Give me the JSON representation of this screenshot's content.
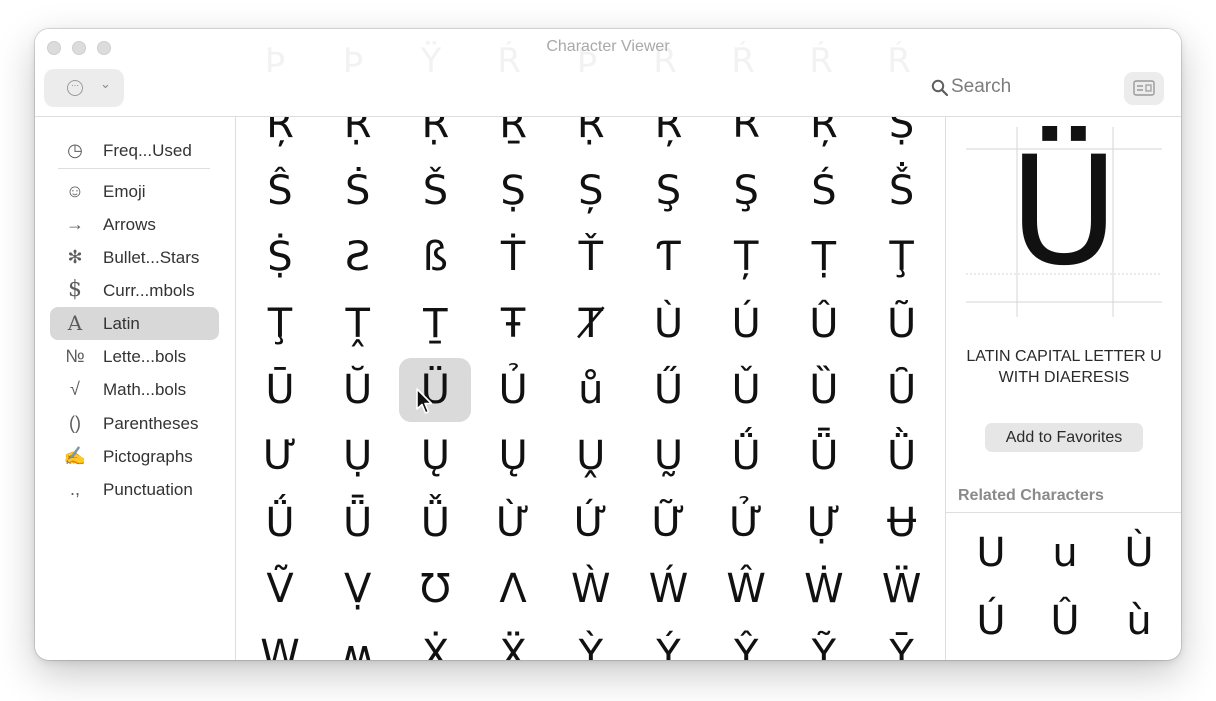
{
  "window": {
    "title": "Character Viewer"
  },
  "toolbar": {
    "action_label": "⋯",
    "search_placeholder": "Search"
  },
  "ghost_glyphs": [
    "Þ",
    "Þ",
    "Ÿ",
    "Ŕ",
    "Þ",
    "Ŕ",
    "Ŕ",
    "Ŕ",
    "Ŕ"
  ],
  "sidebar": {
    "items": [
      {
        "icon": "◷",
        "icon_name": "clock-icon",
        "label": "Freq...Used",
        "selected": false
      },
      {
        "icon": "☺",
        "icon_name": "smiley-icon",
        "label": "Emoji",
        "selected": false
      },
      {
        "icon": "→",
        "icon_name": "arrow-icon",
        "label": "Arrows",
        "selected": false
      },
      {
        "icon": "✻",
        "icon_name": "asterisk-icon",
        "label": "Bullet...Stars",
        "selected": false
      },
      {
        "icon": "$",
        "icon_name": "dollar-icon",
        "label": "Curr...mbols",
        "selected": false
      },
      {
        "icon": "A",
        "icon_name": "latin-a-icon",
        "label": "Latin",
        "selected": true
      },
      {
        "icon": "№",
        "icon_name": "numero-icon",
        "label": "Lette...bols",
        "selected": false
      },
      {
        "icon": "√",
        "icon_name": "square-root-icon",
        "label": "Math...bols",
        "selected": false
      },
      {
        "icon": "()",
        "icon_name": "parentheses-icon",
        "label": "Parentheses",
        "selected": false
      },
      {
        "icon": "✍",
        "icon_name": "signature-icon",
        "label": "Pictographs",
        "selected": false
      },
      {
        "icon": ".,",
        "icon_name": "punctuation-icon",
        "label": "Punctuation",
        "selected": false
      }
    ]
  },
  "grid": {
    "rows": [
      [
        "Ŗ",
        "Ṛ",
        "Ṝ",
        "Ṟ",
        "Ṛ",
        "Ŗ",
        "Ř",
        "Ŗ",
        "Ṣ"
      ],
      [
        "Ŝ",
        "Ṡ",
        "Š",
        "Ṣ",
        "Ș",
        "Ş",
        "Ş",
        "Ś",
        "Ṧ"
      ],
      [
        "Ṩ",
        "Ƨ",
        "ß",
        "Ṫ",
        "Ť",
        "Ƭ",
        "Ț",
        "Ṭ",
        "Ţ"
      ],
      [
        "Ţ",
        "Ṱ",
        "Ṯ",
        "Ŧ",
        "Ⱦ",
        "Ù",
        "Ú",
        "Û",
        "Ũ"
      ],
      [
        "Ū",
        "Ŭ",
        "Ü",
        "Ủ",
        "ů",
        "Ű",
        "Ǔ",
        "Ȕ",
        "Ȗ"
      ],
      [
        "Ư",
        "Ụ",
        "Ų",
        "Ų",
        "Ṷ",
        "Ṵ",
        "Ǘ",
        "Ǖ",
        "Ǜ"
      ],
      [
        "Ǘ",
        "Ǖ",
        "Ǚ",
        "Ừ",
        "Ứ",
        "Ữ",
        "Ử",
        "Ự",
        "Ʉ"
      ],
      [
        "Ṽ",
        "Ṿ",
        "Ʊ",
        "Ʌ",
        "Ẁ",
        "Ẃ",
        "Ŵ",
        "Ẇ",
        "Ẅ"
      ],
      [
        "W",
        "ʍ",
        "Ẋ",
        "Ẍ",
        "Ỳ",
        "Ý",
        "Ŷ",
        "Ỹ",
        "Ȳ"
      ]
    ],
    "selected_row": 4,
    "selected_col": 2
  },
  "inspector": {
    "preview_glyph": "Ü",
    "char_name": "LATIN CAPITAL LETTER U WITH DIAERESIS",
    "favorites_button": "Add to Favorites",
    "related_title": "Related Characters",
    "related": [
      "U",
      "u",
      "Ù",
      "Ú",
      "Û",
      "ù"
    ]
  }
}
